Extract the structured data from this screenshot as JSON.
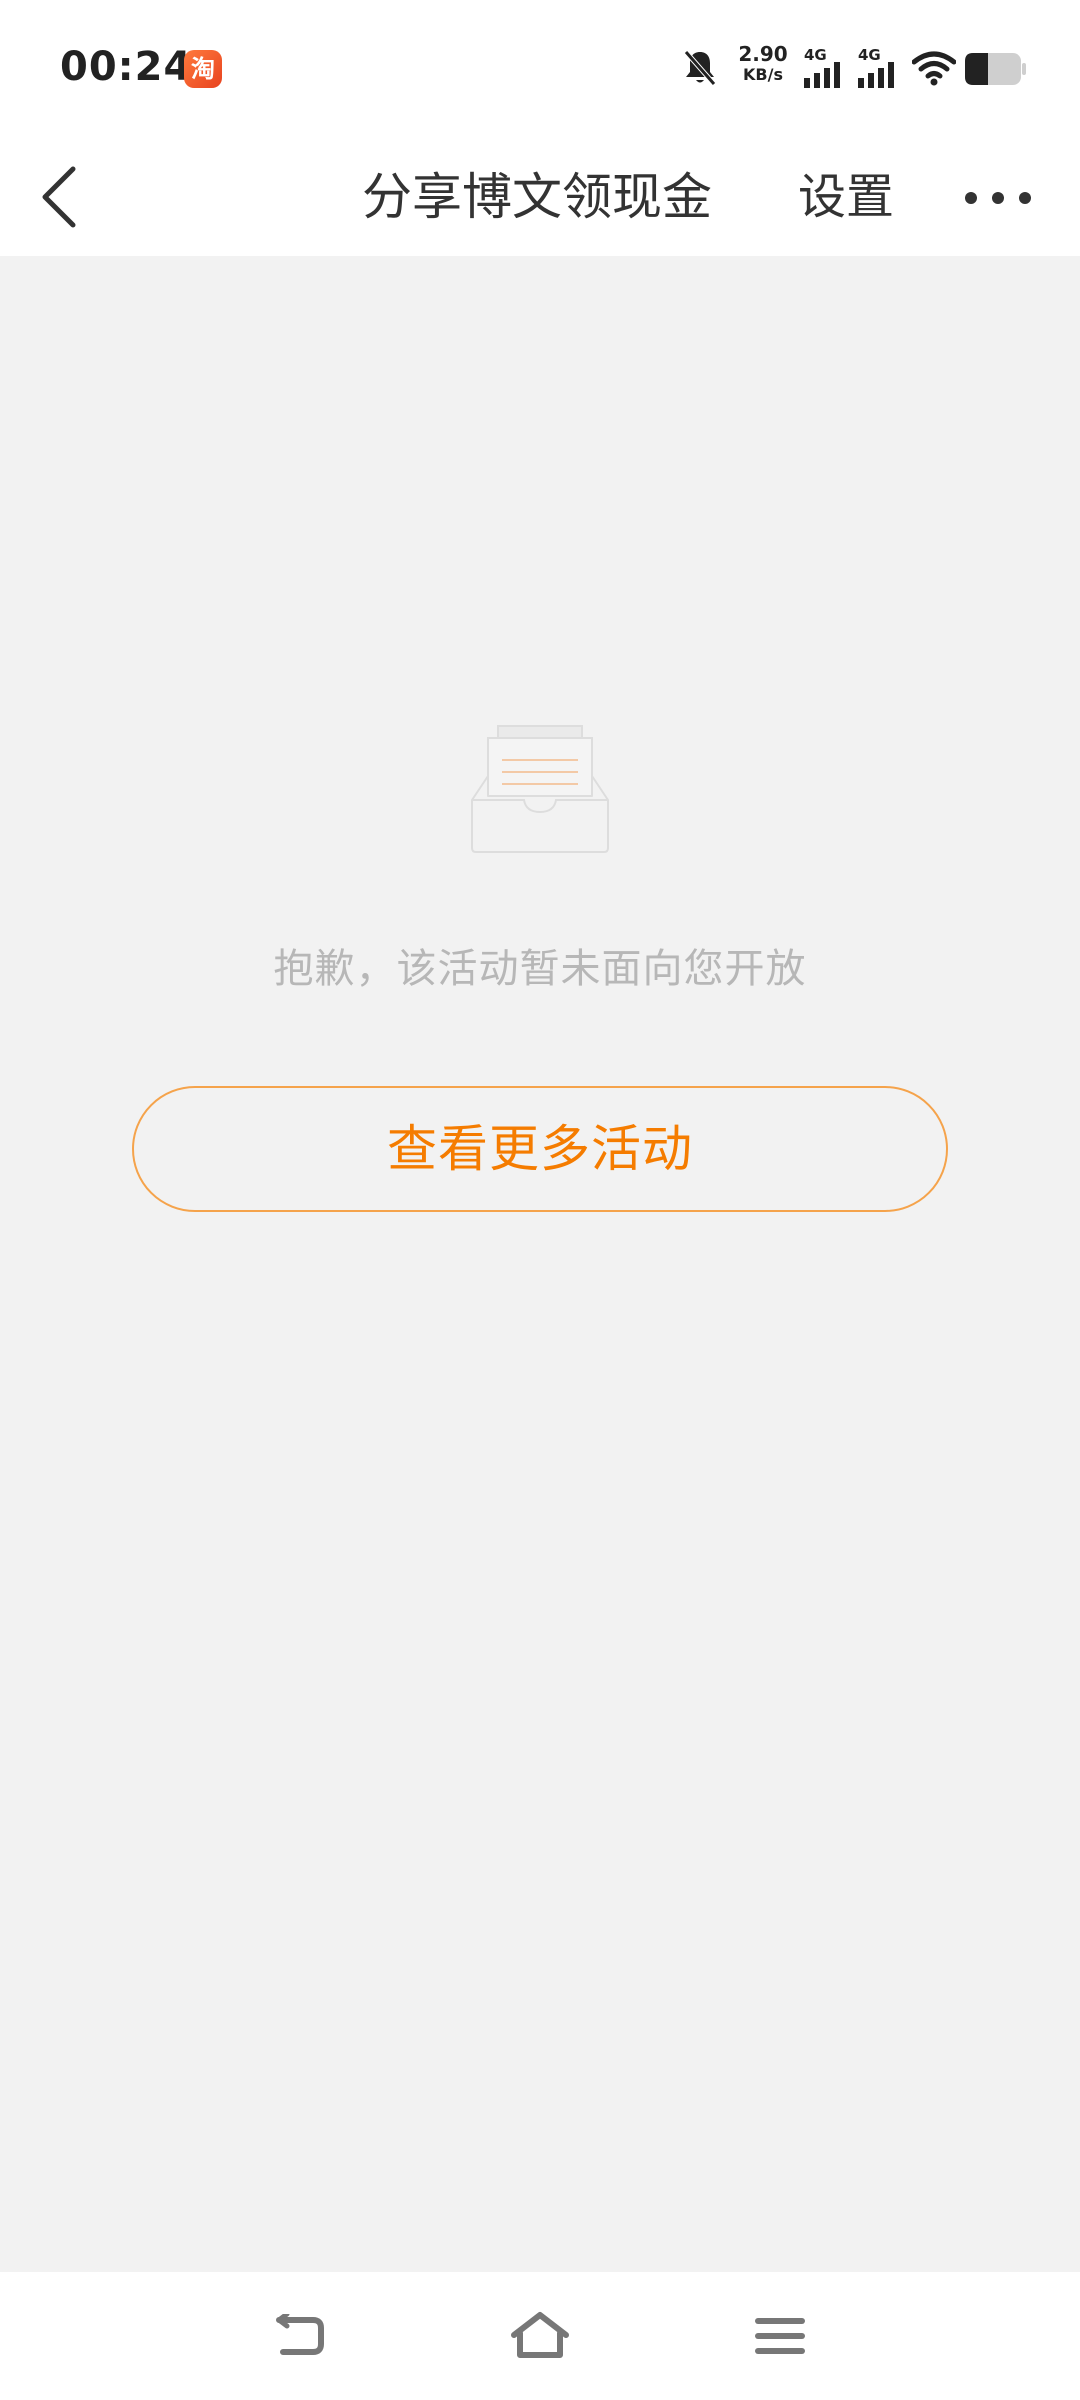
{
  "status_bar": {
    "time": "00:24",
    "app_badge": "淘",
    "net_speed_value": "2.90",
    "net_speed_unit": "KB/s",
    "sim1_label": "4G",
    "sim2_label": "4G",
    "icons": [
      "taobao-app-icon",
      "mute-bell-icon",
      "signal-icon",
      "signal-icon",
      "wifi-icon",
      "battery-icon"
    ]
  },
  "header": {
    "title": "分享博文领现金",
    "settings_label": "设置",
    "back_icon": "chevron-left-icon",
    "more_icon": "more-dots-icon"
  },
  "main": {
    "illustration_icon": "empty-inbox-icon",
    "empty_message": "抱歉，该活动暂未面向您开放",
    "more_button_label": "查看更多活动"
  },
  "nav_bar": {
    "icons": [
      "back-nav-icon",
      "home-icon",
      "menu-icon"
    ]
  },
  "colors": {
    "accent": "#f57c00",
    "button_border": "#f5a34b",
    "background": "#f2f2f2",
    "muted_text": "#b7b7b7"
  }
}
